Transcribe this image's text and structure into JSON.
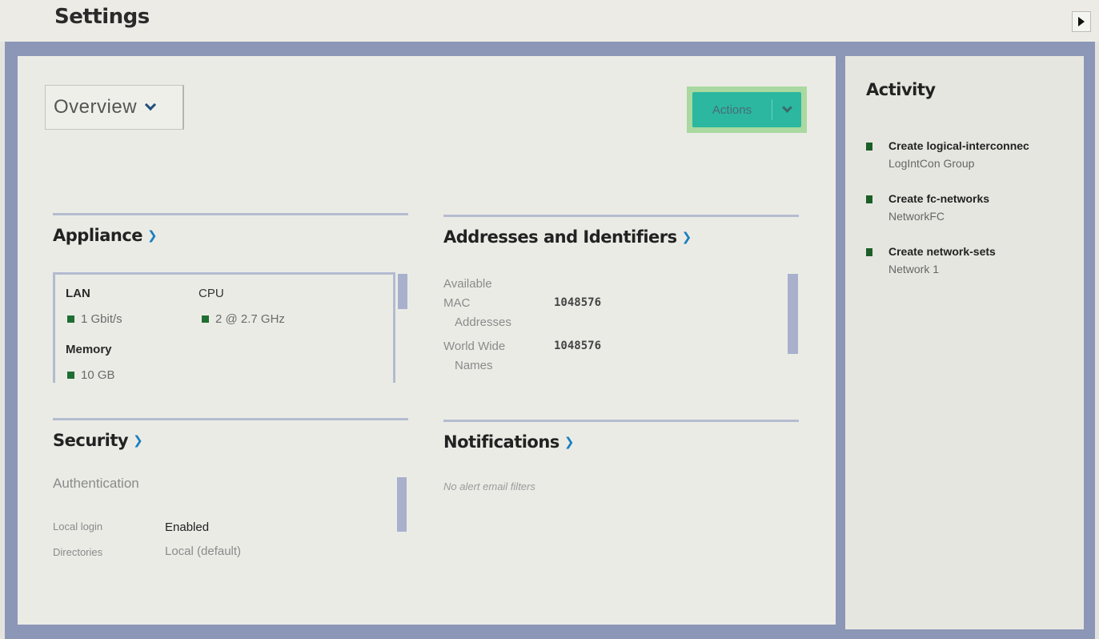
{
  "header": {
    "title": "Settings"
  },
  "view_select": {
    "label": "Overview"
  },
  "actions_button": {
    "label": "Actions"
  },
  "appliance": {
    "title": "Appliance",
    "lan_label": "LAN",
    "lan_value": "1 Gbit/s",
    "cpu_label": "CPU",
    "cpu_value": "2 @ 2.7 GHz",
    "memory_label": "Memory",
    "memory_value": "10 GB"
  },
  "addresses": {
    "title": "Addresses and Identifiers",
    "available_label": "Available",
    "mac_label": "MAC",
    "mac_label2": "Addresses",
    "mac_value": "1048576",
    "wwn_label": "World Wide",
    "wwn_label2": "Names",
    "wwn_value": "1048576"
  },
  "security": {
    "title": "Security",
    "subtitle": "Authentication",
    "local_login_label": "Local login",
    "local_login_value": "Enabled",
    "directories_label": "Directories",
    "directories_value": "Local (default)"
  },
  "notifications": {
    "title": "Notifications",
    "empty_text": "No alert email filters"
  },
  "activity": {
    "title": "Activity",
    "items": [
      {
        "line1": "Create logical-interconnec",
        "line2": "LogIntCon Group"
      },
      {
        "line1": "Create fc-networks",
        "line2": "NetworkFC"
      },
      {
        "line1": "Create network-sets",
        "line2": "Network 1"
      }
    ]
  },
  "colors": {
    "accent": "#2bb7a0",
    "status_ok": "#1f6f32",
    "band": "#8c96b6",
    "link": "#1a7fc0"
  }
}
